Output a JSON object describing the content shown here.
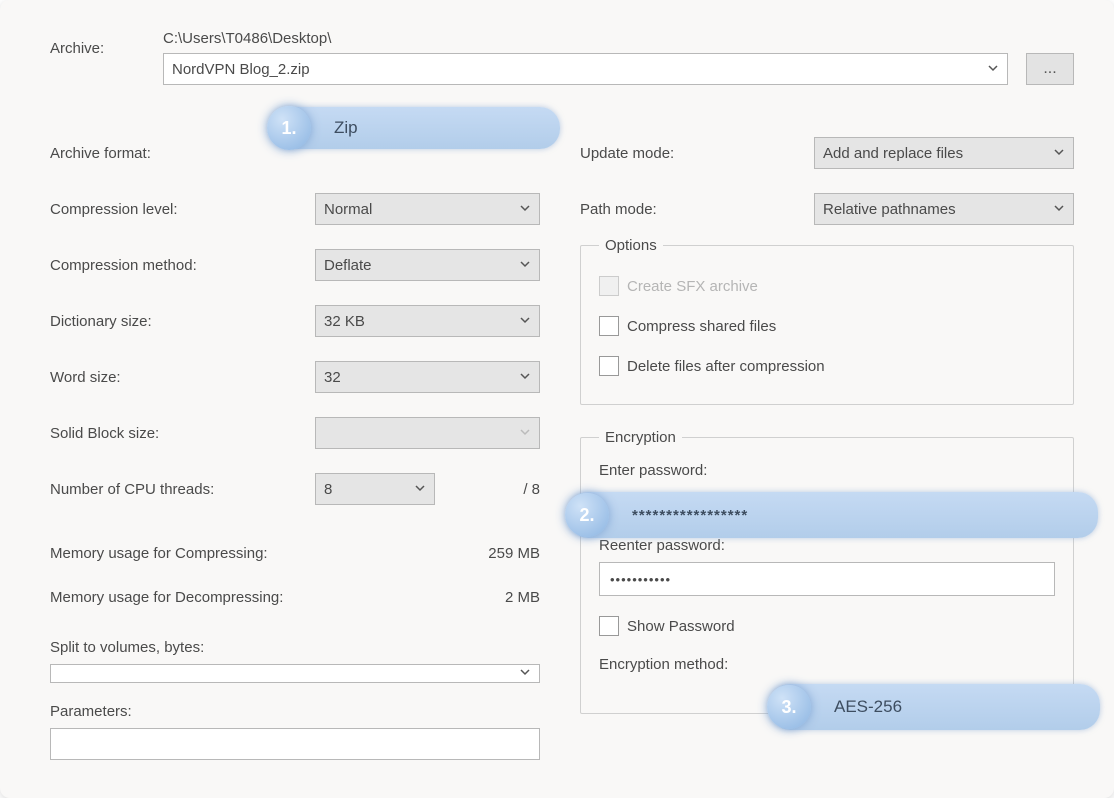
{
  "archive": {
    "label": "Archive:",
    "path": "C:\\Users\\T0486\\Desktop\\",
    "filename": "NordVPN Blog_2.zip",
    "browse_tooltip": "..."
  },
  "left": {
    "archive_format": {
      "label": "Archive format:"
    },
    "compression_level": {
      "label": "Compression level:",
      "value": "Normal"
    },
    "compression_method": {
      "label": "Compression method:",
      "value": "Deflate"
    },
    "dictionary_size": {
      "label": "Dictionary size:",
      "value": "32 KB"
    },
    "word_size": {
      "label": "Word size:",
      "value": "32"
    },
    "solid_block": {
      "label": "Solid Block size:",
      "value": ""
    },
    "cpu_threads": {
      "label": "Number of CPU threads:",
      "value": "8",
      "suffix": "/ 8"
    },
    "mem_compress": {
      "label": "Memory usage for Compressing:",
      "value": "259 MB"
    },
    "mem_decompress": {
      "label": "Memory usage for Decompressing:",
      "value": "2 MB"
    },
    "split_volumes": {
      "label": "Split to volumes, bytes:",
      "value": ""
    },
    "parameters": {
      "label": "Parameters:",
      "value": ""
    }
  },
  "right": {
    "update_mode": {
      "label": "Update mode:",
      "value": "Add and replace files"
    },
    "path_mode": {
      "label": "Path mode:",
      "value": "Relative pathnames"
    },
    "options": {
      "legend": "Options",
      "sfx": "Create SFX archive",
      "shared": "Compress shared files",
      "delete_after": "Delete files after compression"
    },
    "encryption": {
      "legend": "Encryption",
      "enter_pw_label": "Enter password:",
      "reenter_pw_label": "Reenter password:",
      "reenter_pw_value": "•••••••••••",
      "show_pw": "Show Password",
      "method_label": "Encryption method:"
    }
  },
  "callouts": {
    "c1": {
      "num": "1.",
      "text": "Zip"
    },
    "c2": {
      "num": "2.",
      "text": "*****************"
    },
    "c3": {
      "num": "3.",
      "text": "AES-256"
    }
  }
}
